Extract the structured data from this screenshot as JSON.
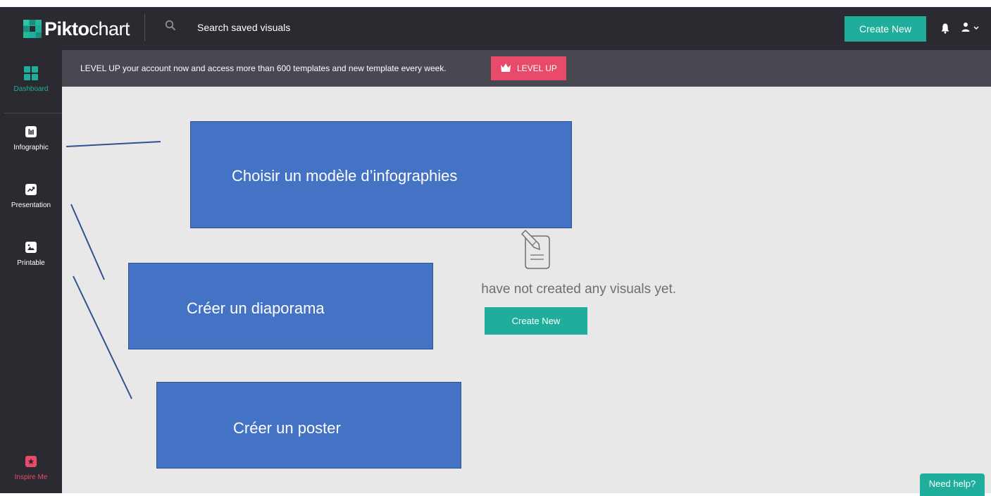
{
  "header": {
    "logo": {
      "bold": "Pikto",
      "thin": "chart"
    },
    "search": {
      "icon": "search-icon",
      "placeholder": "Search saved visuals"
    },
    "create_new_label": "Create New",
    "icons": [
      "bell-icon",
      "user-menu-icon"
    ]
  },
  "sidebar": {
    "items": [
      {
        "label": "Dashboard",
        "icon": "dashboard-grid-icon",
        "active": true
      },
      {
        "label": "Infographic",
        "icon": "infographic-icon"
      },
      {
        "label": "Presentation",
        "icon": "presentation-icon"
      },
      {
        "label": "Printable",
        "icon": "printable-icon"
      }
    ],
    "bottom": {
      "label": "Inspire Me",
      "icon": "star-icon"
    }
  },
  "banner": {
    "text": "LEVEL UP your account now and access more than 600 templates and new template every week.",
    "button_label": "LEVEL UP",
    "button_icon": "crown-icon"
  },
  "main": {
    "empty_icon": "document-pencil-icon",
    "empty_text": "have not created any visuals yet.",
    "create_new_label": "Create New"
  },
  "help_button_label": "Need help?",
  "annotations": [
    {
      "text": "Choisir un modèle d’infographies"
    },
    {
      "text": "Créer un diaporama"
    },
    {
      "text": "Créer un poster"
    }
  ],
  "colors": {
    "topbar": "#2b2a30",
    "banner": "#484752",
    "accent_teal": "#1fae9b",
    "level_up_pink": "#e84a69",
    "annotation_blue": "#4472c4",
    "active_nav": "#1fae9b",
    "inspire_me": "#e84a69"
  }
}
